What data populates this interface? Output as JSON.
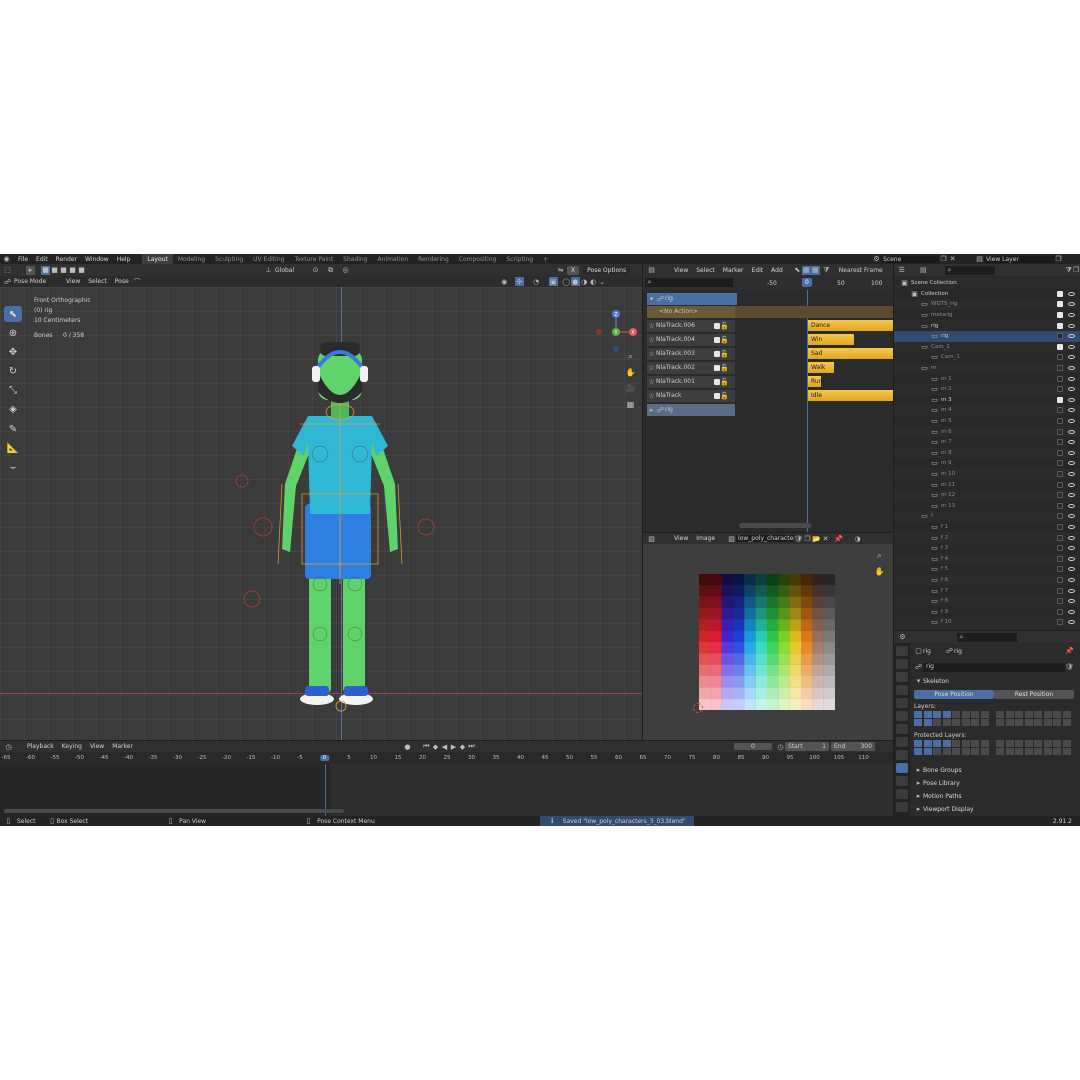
{
  "topbar": {
    "menus": [
      "File",
      "Edit",
      "Render",
      "Window",
      "Help"
    ],
    "workspaces": [
      "Layout",
      "Modeling",
      "Sculpting",
      "UV Editing",
      "Texture Paint",
      "Shading",
      "Animation",
      "Rendering",
      "Compositing",
      "Scripting"
    ],
    "active_workspace": "Layout",
    "add_tab": "+",
    "scene": "Scene",
    "view_layer": "View Layer"
  },
  "viewport": {
    "mode": "Pose Mode",
    "menus": [
      "View",
      "Select",
      "Pose"
    ],
    "transform_orientation": "Global",
    "pose_options": "Pose Options",
    "x_mirror": "X",
    "overlay": {
      "view_name": "Front Orthographic",
      "object": "(0) rig",
      "scale": "10 Centimeters",
      "bones_label": "Bones",
      "bones_value": "0 / 358"
    },
    "gizmo": {
      "z": "Z",
      "y": "Y",
      "x": "X"
    }
  },
  "nla": {
    "menus": [
      "View",
      "Select",
      "Marker",
      "Edit",
      "Add"
    ],
    "snap": "Nearest Frame",
    "ruler": [
      "-50",
      "0",
      "50",
      "100"
    ],
    "current_frame": "0",
    "object_name": "rig",
    "no_action": "<No Action>",
    "tracks": [
      {
        "name": "NlaTrack.006",
        "strip": "Dance"
      },
      {
        "name": "NlaTrack.004",
        "strip": "Win"
      },
      {
        "name": "NlaTrack.003",
        "strip": "Sad"
      },
      {
        "name": "NlaTrack.002",
        "strip": "Walk"
      },
      {
        "name": "NlaTrack.001",
        "strip": "Run"
      },
      {
        "name": "NlaTrack",
        "strip": "Idle"
      }
    ],
    "bottom_object": "rig"
  },
  "image_editor": {
    "menus": [
      "View",
      "Image"
    ],
    "image_name": "low_poly_character..."
  },
  "outliner": {
    "rows": [
      {
        "name": "Scene Collection",
        "indent": 0,
        "dim": false,
        "chk": false
      },
      {
        "name": "Collection",
        "indent": 1,
        "dim": false,
        "chk": true
      },
      {
        "name": "WGTS_rig",
        "indent": 2,
        "dim": true,
        "chk": true
      },
      {
        "name": "metarig",
        "indent": 2,
        "dim": true,
        "chk": true
      },
      {
        "name": "rig",
        "indent": 2,
        "dim": false,
        "chk": true
      },
      {
        "name": "rig",
        "indent": 3,
        "dim": false,
        "chk": false,
        "selected": true
      },
      {
        "name": "Cam_1",
        "indent": 2,
        "dim": true,
        "chk": true
      },
      {
        "name": "Cam_1",
        "indent": 3,
        "dim": true,
        "chk": false
      },
      {
        "name": "m",
        "indent": 2,
        "dim": true,
        "chk": false
      },
      {
        "name": "m 1",
        "indent": 3,
        "dim": true,
        "chk": false
      },
      {
        "name": "m 2",
        "indent": 3,
        "dim": true,
        "chk": false
      },
      {
        "name": "m 3",
        "indent": 3,
        "dim": false,
        "chk": true
      },
      {
        "name": "m 4",
        "indent": 3,
        "dim": true,
        "chk": false
      },
      {
        "name": "m 5",
        "indent": 3,
        "dim": true,
        "chk": false
      },
      {
        "name": "m 6",
        "indent": 3,
        "dim": true,
        "chk": false
      },
      {
        "name": "m 7",
        "indent": 3,
        "dim": true,
        "chk": false
      },
      {
        "name": "m 8",
        "indent": 3,
        "dim": true,
        "chk": false
      },
      {
        "name": "m 9",
        "indent": 3,
        "dim": true,
        "chk": false
      },
      {
        "name": "m 10",
        "indent": 3,
        "dim": true,
        "chk": false
      },
      {
        "name": "m 11",
        "indent": 3,
        "dim": true,
        "chk": false
      },
      {
        "name": "m 12",
        "indent": 3,
        "dim": true,
        "chk": false
      },
      {
        "name": "m 13",
        "indent": 3,
        "dim": true,
        "chk": false
      },
      {
        "name": "f",
        "indent": 2,
        "dim": true,
        "chk": false
      },
      {
        "name": "f 1",
        "indent": 3,
        "dim": true,
        "chk": false
      },
      {
        "name": "f 2",
        "indent": 3,
        "dim": true,
        "chk": false
      },
      {
        "name": "f 3",
        "indent": 3,
        "dim": true,
        "chk": false
      },
      {
        "name": "f 4",
        "indent": 3,
        "dim": true,
        "chk": false
      },
      {
        "name": "f 5",
        "indent": 3,
        "dim": true,
        "chk": false
      },
      {
        "name": "f 6",
        "indent": 3,
        "dim": true,
        "chk": false
      },
      {
        "name": "f 7",
        "indent": 3,
        "dim": true,
        "chk": false
      },
      {
        "name": "f 8",
        "indent": 3,
        "dim": true,
        "chk": false
      },
      {
        "name": "f 9",
        "indent": 3,
        "dim": true,
        "chk": false
      },
      {
        "name": "f 10",
        "indent": 3,
        "dim": true,
        "chk": false
      }
    ]
  },
  "properties": {
    "breadcrumb_a": "rig",
    "breadcrumb_b": "rig",
    "data_name": "rig",
    "skeleton_title": "Skeleton",
    "pose_position": "Pose Position",
    "rest_position": "Rest Position",
    "layers_label": "Layers:",
    "protected_layers_label": "Protected Layers:",
    "panels": [
      "Bone Groups",
      "Pose Library",
      "Motion Paths",
      "Viewport Display"
    ]
  },
  "timeline": {
    "menus": [
      "Playback",
      "Keying",
      "View",
      "Marker"
    ],
    "current_frame": "0",
    "start_label": "Start",
    "start_value": "1",
    "end_label": "End",
    "end_value": "300",
    "ruler": [
      "-65",
      "-60",
      "-55",
      "-50",
      "-45",
      "-40",
      "-35",
      "-30",
      "-25",
      "-20",
      "-15",
      "-10",
      "-5",
      "0",
      "5",
      "10",
      "15",
      "20",
      "25",
      "30",
      "35",
      "40",
      "45",
      "50",
      "55",
      "60",
      "65",
      "70",
      "75",
      "80",
      "85",
      "90",
      "95",
      "100",
      "105",
      "110"
    ]
  },
  "statusbar": {
    "select": "Select",
    "box_select": "Box Select",
    "pan_view": "Pan View",
    "context_menu": "Pose Context Menu",
    "message": "Saved \"low_poly_characters_3_03.blend\"",
    "version": "2.91.2"
  },
  "colors": {
    "accent": "#4a6fa5",
    "strip": "#f0b83a",
    "character_skin": "#5fd36a",
    "shirt": "#2fb7d6",
    "shorts": "#2f7fe0"
  }
}
